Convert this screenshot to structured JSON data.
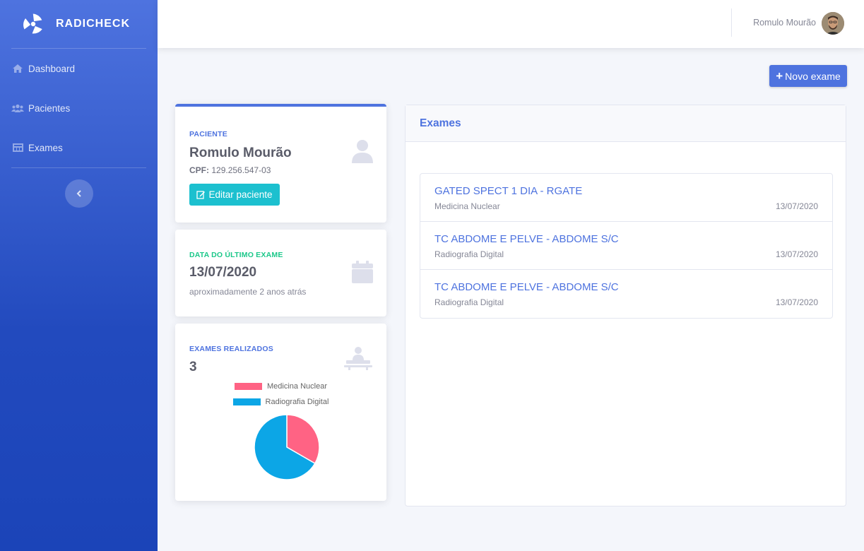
{
  "app": {
    "brand": "RADICHECK"
  },
  "sidebar": {
    "items": [
      {
        "label": "Dashboard",
        "icon": "home-icon"
      },
      {
        "label": "Pacientes",
        "icon": "users-icon"
      },
      {
        "label": "Exames",
        "icon": "clipboard-icon"
      }
    ],
    "collapse_icon": "chevron-left-icon"
  },
  "topbar": {
    "user_name": "Romulo Mourão"
  },
  "actions": {
    "new_exam_label": "Novo exame"
  },
  "patient_card": {
    "label": "PACIENTE",
    "name": "Romulo Mourão",
    "cpf_label": "CPF:",
    "cpf_value": "129.256.547-03",
    "edit_label": "Editar paciente"
  },
  "last_exam_card": {
    "label": "DATA DO ÚLTIMO EXAME",
    "date": "13/07/2020",
    "relative": "aproximadamente 2 anos atrás"
  },
  "count_card": {
    "label": "EXAMES REALIZADOS",
    "count": "3"
  },
  "chart_data": {
    "type": "pie",
    "title": "",
    "legend": "top",
    "categories": [
      "Medicina Nuclear",
      "Radiografia Digital"
    ],
    "values": [
      1,
      2
    ],
    "colors": [
      "#ff6384",
      "#0ca6e6"
    ]
  },
  "exams_panel": {
    "title": "Exames",
    "rows": [
      {
        "title": "GATED SPECT 1 DIA - RGATE",
        "category": "Medicina Nuclear",
        "date": "13/07/2020"
      },
      {
        "title": "TC ABDOME E PELVE - ABDOME S/C",
        "category": "Radiografia Digital",
        "date": "13/07/2020"
      },
      {
        "title": "TC ABDOME E PELVE - ABDOME S/C",
        "category": "Radiografia Digital",
        "date": "13/07/2020"
      }
    ]
  }
}
